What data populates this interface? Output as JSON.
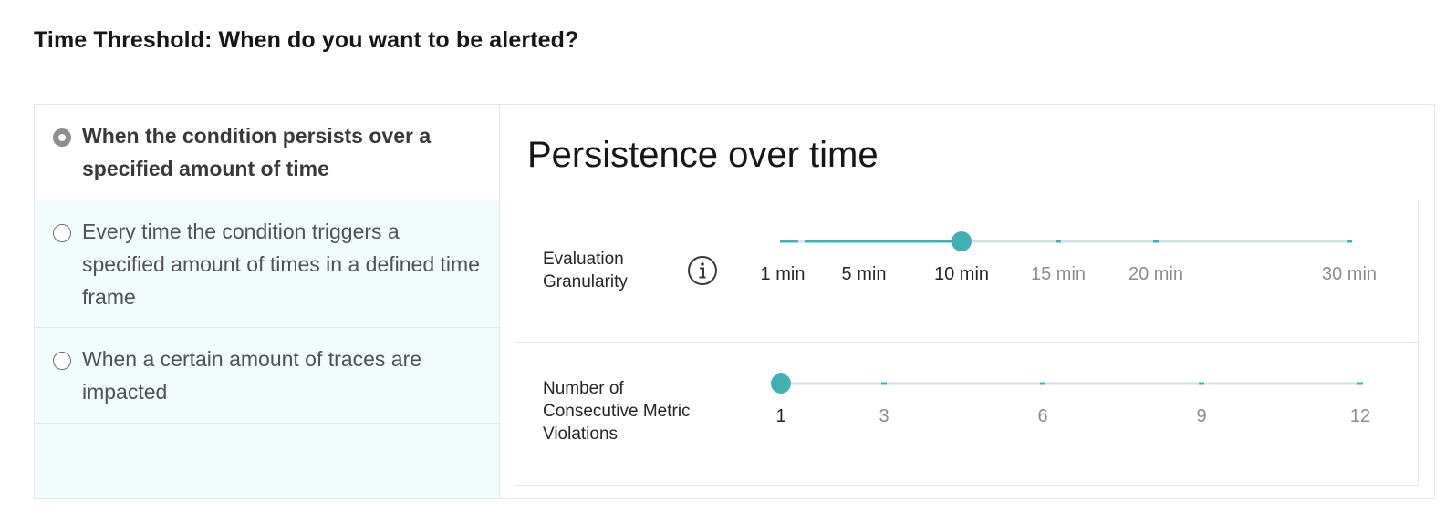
{
  "page": {
    "title": "Time Threshold: When do you want to be alerted?"
  },
  "options": [
    {
      "label": "When the condition persists over a specified amount of time",
      "selected": true
    },
    {
      "label": "Every time the condition triggers a specified amount of times in a defined time frame",
      "selected": false
    },
    {
      "label": "When a certain amount of traces are impacted",
      "selected": false
    }
  ],
  "detail": {
    "title": "Persistence over time",
    "granularity": {
      "label_line1": "Evaluation",
      "label_line2": "Granularity",
      "info_icon": "info-icon",
      "ticks": [
        "1 min",
        "5 min",
        "10 min",
        "15 min",
        "20 min",
        "30 min"
      ],
      "selected_value": "10 min"
    },
    "violations": {
      "label_line1": "Number of",
      "label_line2": "Consecutive Metric",
      "label_line3": "Violations",
      "ticks": [
        "1",
        "3",
        "6",
        "9",
        "12"
      ],
      "selected_value": "1"
    }
  },
  "colors": {
    "accent": "#42b0b2",
    "track": "#d5e2e4",
    "active_text": "#262626",
    "inactive_text": "#8d8d8d"
  }
}
